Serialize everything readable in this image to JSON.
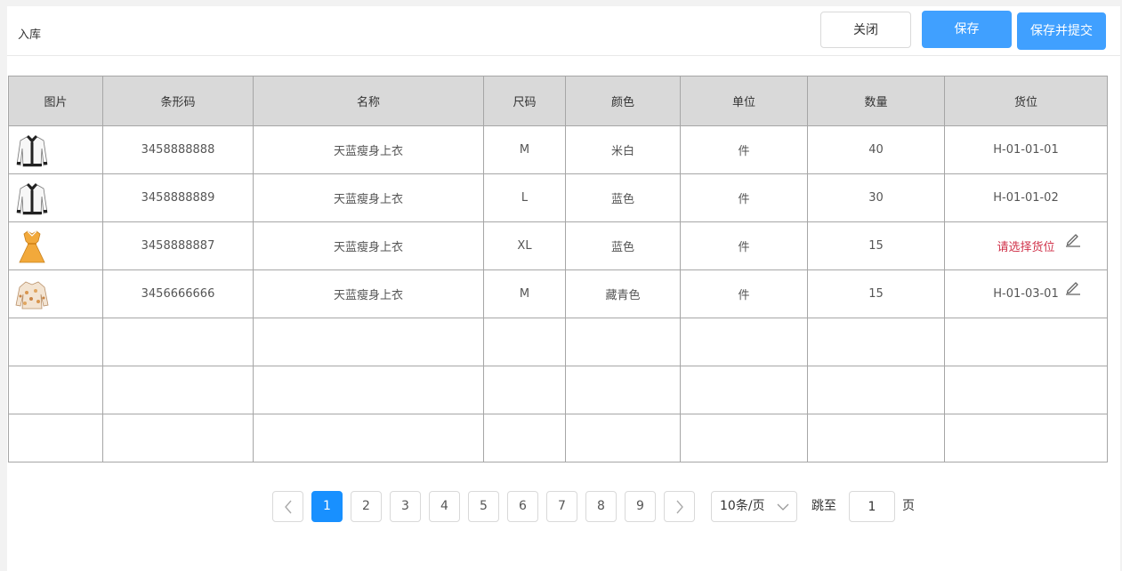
{
  "header": {
    "title": "入库",
    "close_label": "关闭",
    "save_label": "保存",
    "save_submit_label": "保存并提交"
  },
  "table": {
    "columns": [
      "图片",
      "条形码",
      "名称",
      "尺码",
      "颜色",
      "单位",
      "数量",
      "货位"
    ],
    "rows": [
      {
        "image": "white-cardigan-icon",
        "barcode": "3458888888",
        "name": "天蓝瘦身上衣",
        "size": "M",
        "color": "米白",
        "unit": "件",
        "qty": "40",
        "location": "H-01-01-01",
        "location_warn": false,
        "editable": false
      },
      {
        "image": "white-cardigan-icon",
        "barcode": "3458888889",
        "name": "天蓝瘦身上衣",
        "size": "L",
        "color": "蓝色",
        "unit": "件",
        "qty": "30",
        "location": "H-01-01-02",
        "location_warn": false,
        "editable": false
      },
      {
        "image": "yellow-dress-icon",
        "barcode": "3458888887",
        "name": "天蓝瘦身上衣",
        "size": "XL",
        "color": "蓝色",
        "unit": "件",
        "qty": "15",
        "location": "请选择货位",
        "location_warn": true,
        "editable": true
      },
      {
        "image": "floral-blouse-icon",
        "barcode": "3456666666",
        "name": "天蓝瘦身上衣",
        "size": "M",
        "color": "藏青色",
        "unit": "件",
        "qty": "15",
        "location": "H-01-03-01",
        "location_warn": false,
        "editable": true
      }
    ],
    "empty_rows": 3
  },
  "pagination": {
    "pages": [
      "1",
      "2",
      "3",
      "4",
      "5",
      "6",
      "7",
      "8",
      "9"
    ],
    "current": "1",
    "page_size_label": "10条/页",
    "jump_label": "跳至",
    "jump_value": "1",
    "page_suffix": "页"
  },
  "colors": {
    "primary": "#40a0ff",
    "active_page": "#1890ff",
    "warn": "#d0324a",
    "header_bg": "#d9d9d9"
  }
}
